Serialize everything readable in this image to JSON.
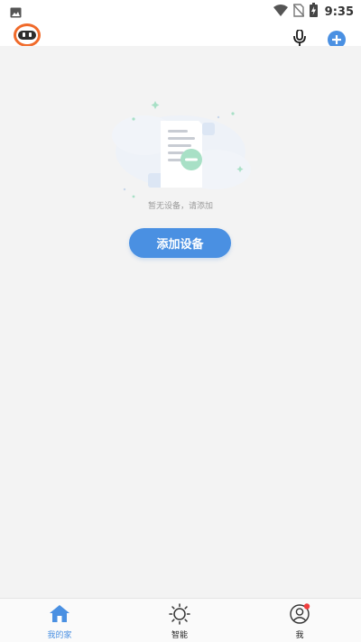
{
  "status_bar": {
    "time": "9:35",
    "icons": [
      "image-notification-icon",
      "wifi-icon",
      "no-sim-icon",
      "battery-charging-icon"
    ]
  },
  "top_bar": {
    "avatar_icon": "robot-avatar-icon",
    "mic_icon": "microphone-icon",
    "add_icon": "plus-circle-icon",
    "accent": "#4a90e2",
    "avatar_ring": "#f06a2a"
  },
  "empty_state": {
    "illustration": "empty-document-illustration",
    "message": "暂无设备，请添加",
    "button_label": "添加设备",
    "button_color": "#4a90e2"
  },
  "tab_bar": {
    "tabs": [
      {
        "label": "我的家",
        "icon": "home-icon",
        "active": true
      },
      {
        "label": "智能",
        "icon": "sun-icon",
        "active": false
      },
      {
        "label": "我",
        "icon": "user-icon",
        "active": false,
        "badge": true
      }
    ],
    "active_color": "#4a90e2",
    "badge_color": "#f03e3e"
  }
}
